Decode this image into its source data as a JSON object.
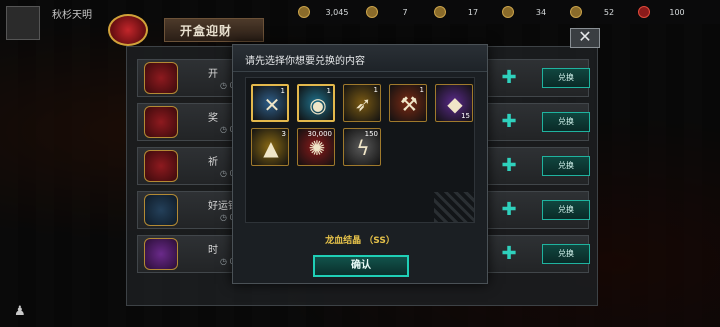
{
  "player": {
    "name": "秋杉天明"
  },
  "header": {
    "title": "开盒迎财"
  },
  "resources": [
    {
      "icon": "silver-coin-icon",
      "value": "3,045"
    },
    {
      "icon": "gold-token-icon",
      "value": "7"
    },
    {
      "icon": "gem-token-icon",
      "value": "17"
    },
    {
      "icon": "energy-token-icon",
      "value": "34"
    },
    {
      "icon": "stamina-token-icon",
      "value": "52"
    },
    {
      "icon": "crystal-token-icon",
      "value": "100"
    }
  ],
  "rows": [
    {
      "label": "开",
      "time": "0d",
      "action": "兑换"
    },
    {
      "label": "奖",
      "time": "0d",
      "action": "兑换"
    },
    {
      "label": "祈",
      "time": "0d",
      "action": "兑换"
    },
    {
      "label": "好运铜",
      "time": "0d",
      "action": "兑换"
    },
    {
      "label": "时",
      "time": "0d",
      "action": "兑换"
    }
  ],
  "modal": {
    "title": "请先选择你想要兑换的内容",
    "items": [
      {
        "name": "crossed-blades-icon",
        "qty": "1",
        "color": "#2f5f8a",
        "selected": true
      },
      {
        "name": "blue-orb-icon",
        "qty": "1",
        "color": "#1f6f8a",
        "selected": true
      },
      {
        "name": "gold-blade-icon",
        "qty": "1",
        "color": "#7a5a14",
        "selected": false
      },
      {
        "name": "war-hammer-icon",
        "qty": "1",
        "color": "#7a2a14",
        "selected": false
      },
      {
        "name": "purple-crystal-icon",
        "qty": "15",
        "color": "#5a2a8a",
        "selected": false
      },
      {
        "name": "gold-shard-icon",
        "qty": "3",
        "color": "#8a6a14",
        "selected": false
      },
      {
        "name": "red-rune-icon",
        "qty": "30,000",
        "color": "#8a1a1a",
        "selected": false
      },
      {
        "name": "lightning-coin-icon",
        "qty": "150",
        "color": "#5a5a5a",
        "selected": false
      }
    ],
    "selected_name": "龙血结晶 （SS）",
    "confirm_label": "确认"
  }
}
